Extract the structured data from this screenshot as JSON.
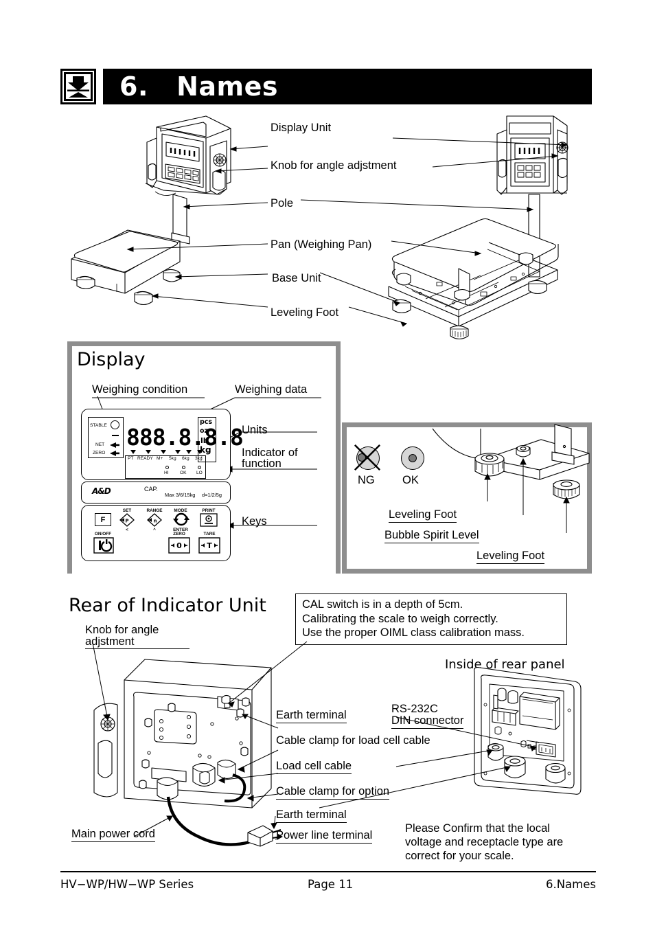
{
  "header": {
    "section_number": "6.",
    "title": "6.   Names",
    "icon": "weight-scale-icon"
  },
  "overview_labels": [
    {
      "text": "Display Unit"
    },
    {
      "text": "Knob for angle adjstment"
    },
    {
      "text": "Pole"
    },
    {
      "text": "Pan (Weighing Pan)"
    },
    {
      "text": "Base Unit"
    },
    {
      "text": "Leveling Foot"
    }
  ],
  "display_panel": {
    "heading": "Display",
    "callouts": {
      "weighing_condition": "Weighing condition",
      "weighing_data": "Weighing data",
      "units": "Units",
      "indicator_of_function_line1": "Indicator of",
      "indicator_of_function_line2": "function",
      "keys": "Keys"
    },
    "indicator_face": {
      "condition_flags": [
        "STABLE",
        "NET",
        "ZERO"
      ],
      "digits": "888.8.8.8",
      "units": [
        "pcs",
        "oz",
        "lb",
        "kg"
      ],
      "marker_labels": [
        "PT",
        "READY",
        "M+",
        "5kg",
        "6kg",
        "3kg"
      ],
      "comparator_labels": [
        "HI",
        "OK",
        "LO"
      ],
      "brand": "A&D",
      "cap_label": "CAP.",
      "capacity": "Max 3/6/15kg",
      "division": "d=1/2/5g",
      "keys": [
        {
          "top": "",
          "face": "F",
          "bottom": ""
        },
        {
          "top": "SET",
          "face": "P",
          "bottom": "<"
        },
        {
          "top": "RANGE",
          "face": "n",
          "bottom": "^"
        },
        {
          "top": "MODE",
          "face": "mode-cycle-icon",
          "bottom": "ENTER"
        },
        {
          "top": "PRINT",
          "face": "print-icon",
          "bottom": ""
        },
        {
          "top": "ON/OFF",
          "face": "I/power-icon",
          "bottom": ""
        },
        {
          "top": "ZERO",
          "face": "+0+",
          "bottom": ""
        },
        {
          "top": "TARE",
          "face": "+T+",
          "bottom": ""
        }
      ]
    }
  },
  "leveling_panel": {
    "ng_label": "NG",
    "ok_label": "OK",
    "callouts": [
      "Leveling Foot",
      "Bubble Spirit Level",
      "Leveling Foot"
    ]
  },
  "rear_section": {
    "heading": "Rear of Indicator Unit",
    "knob_label_line1": "Knob for angle",
    "knob_label_line2": "adjstment",
    "inside_heading": "Inside of rear panel",
    "cal_note": "CAL switch is in a depth of 5cm.\nCalibrating the scale to weigh correctly.\nUse the proper OIML class calibration mass.",
    "rs232_line1": "RS-232C",
    "rs232_line2": "DIN connector",
    "labels": [
      "Earth terminal",
      "Cable clamp for load cell cable",
      "Load cell cable",
      "Cable clamp for option",
      "Earth terminal",
      "Power line terminal",
      "Main power cord"
    ],
    "voltage_note": "Please Confirm that the local\nvoltage and receptacle type are\ncorrect for your scale."
  },
  "footer": {
    "left": "HV−WP/HW−WP Series",
    "center": "Page 11",
    "right": "6.Names"
  },
  "colors": {
    "panel_border": "#8e8e8e",
    "ink": "#000000",
    "bubble_fill": "#d7d7d7"
  }
}
